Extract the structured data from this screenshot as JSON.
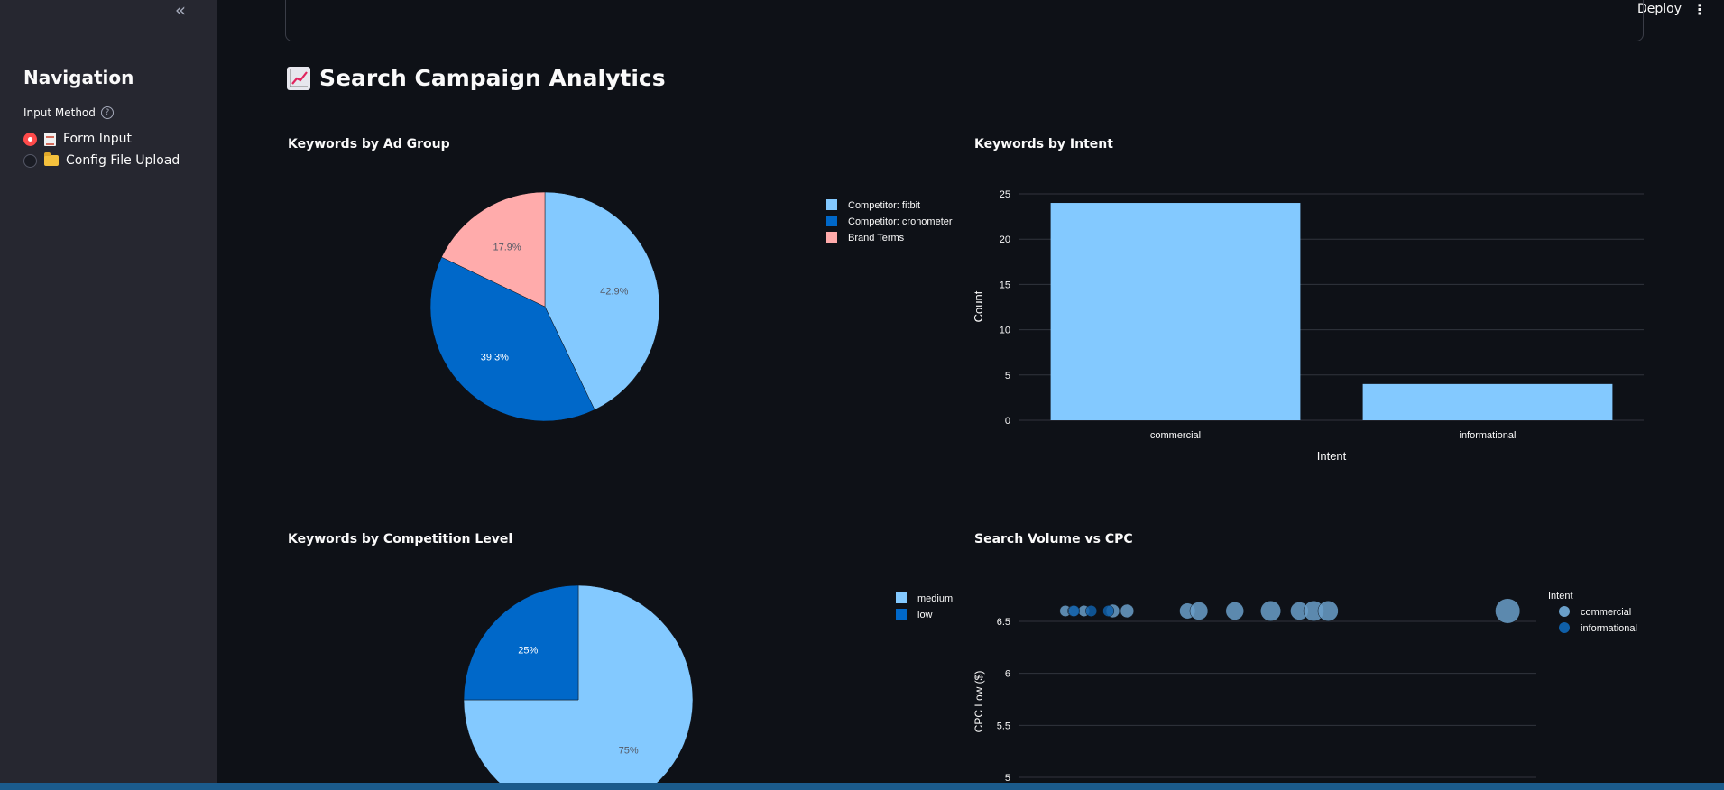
{
  "sidebar": {
    "title": "Navigation",
    "input_method_label": "Input Method",
    "options": [
      {
        "label": "Form Input",
        "selected": true,
        "icon": "document-icon"
      },
      {
        "label": "Config File Upload",
        "selected": false,
        "icon": "folder-icon"
      }
    ]
  },
  "header": {
    "deploy_label": "Deploy"
  },
  "page": {
    "title": "Search Campaign Analytics",
    "title_icon": "chart-increasing-icon"
  },
  "colors": {
    "light_blue": "#83c9ff",
    "dark_blue": "#0068c9",
    "pink": "#ffabab",
    "accent": "#ff4b4b"
  },
  "chart_data": [
    {
      "type": "pie",
      "title": "Keywords by Ad Group",
      "categories": [
        "Competitor: fitbit",
        "Competitor: cronometer",
        "Brand Terms"
      ],
      "values": [
        42.9,
        39.3,
        17.9
      ],
      "labels": [
        "42.9%",
        "39.3%",
        "17.9%"
      ],
      "colors": [
        "#83c9ff",
        "#0068c9",
        "#ffabab"
      ],
      "legend": "right"
    },
    {
      "type": "bar",
      "title": "Keywords by Intent",
      "categories": [
        "commercial",
        "informational"
      ],
      "values": [
        24,
        4
      ],
      "xlabel": "Intent",
      "ylabel": "Count",
      "ylim": [
        0,
        26
      ],
      "yticks": [
        0,
        5,
        10,
        15,
        20,
        25
      ],
      "grid": true
    },
    {
      "type": "pie",
      "title": "Keywords by Competition Level",
      "categories": [
        "medium",
        "low"
      ],
      "values": [
        75,
        25
      ],
      "labels": [
        "75%",
        "25%"
      ],
      "colors": [
        "#83c9ff",
        "#0068c9"
      ],
      "legend": "right"
    },
    {
      "type": "scatter",
      "title": "Search Volume vs CPC",
      "ylabel": "CPC Low ($)",
      "ylim": [
        4.95,
        6.8
      ],
      "yticks": [
        5,
        5.5,
        6,
        6.5
      ],
      "legend_title": "Intent",
      "series": [
        {
          "name": "commercial",
          "x": [
            0.2,
            0.75,
            1.5,
            3.5,
            4.5,
            8.7,
            9.5,
            12,
            14.5,
            16.5,
            17.5,
            18.5,
            31
          ],
          "y": [
            6.6,
            6.6,
            6.6,
            6.6,
            6.6,
            6.6,
            6.6,
            6.6,
            6.6,
            6.6,
            6.6,
            6.6,
            6.6
          ],
          "size": [
            5,
            5,
            5,
            6,
            6,
            7,
            8,
            8,
            9,
            8,
            9,
            9,
            11
          ]
        },
        {
          "name": "informational",
          "x": [
            0.8,
            2,
            3.2
          ],
          "y": [
            6.6,
            6.6,
            6.6
          ],
          "size": [
            5,
            5,
            5
          ]
        }
      ],
      "colors": [
        "#6a9fc9",
        "#0f5fa8"
      ],
      "legend": "top-right"
    }
  ]
}
